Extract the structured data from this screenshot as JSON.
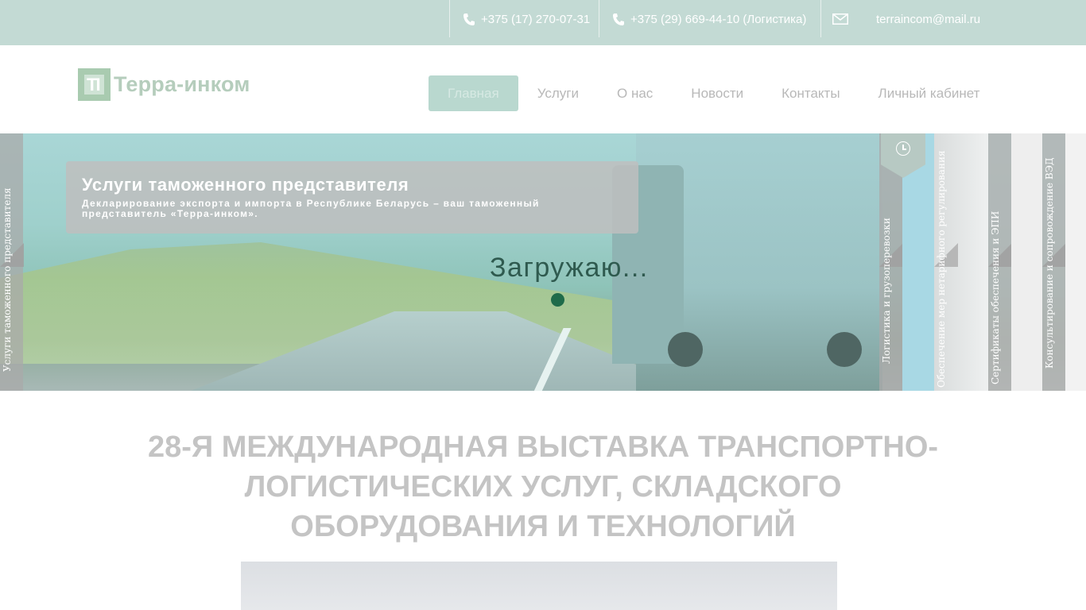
{
  "topbar": {
    "phone1": "+375 (17) 270-07-31",
    "phone2": "+375 (29) 669-44-10 (Логистика)",
    "email": "terraincom@mail.ru",
    "icons": {
      "phone": "phone-icon",
      "email": "envelope-icon"
    }
  },
  "header": {
    "logo_mark": "TI",
    "logo_text": "Терра-инком",
    "nav": [
      {
        "label": "Главная",
        "active": true
      },
      {
        "label": "Услуги"
      },
      {
        "label": "О нас"
      },
      {
        "label": "Новости"
      },
      {
        "label": "Контакты"
      },
      {
        "label": "Личный кабинет"
      }
    ]
  },
  "hero": {
    "caption_title": "Услуги таможенного представителя",
    "caption_text": "Декларирование экспорта и импорта в Республике Беларусь – ваш таможенный представитель «Терра-инком».",
    "loading": "Загружаю...",
    "tabs": [
      {
        "label": "Услуги таможенного представителя"
      },
      {
        "label": "Логистика и грузоперевозки"
      },
      {
        "label": "Обеспечение мер нетарифного регулирования"
      },
      {
        "label": "Сертификаты обеспечения и ЭПИ"
      },
      {
        "label": "Консультирование и сопровождение ВЭД"
      }
    ]
  },
  "main": {
    "news_title": "28-я международная выставка транспортно-логистических услуг, складского оборудования и технологий"
  },
  "colors": {
    "topbar": "#c3dad4",
    "nav_active": "#b9d8cf",
    "loading_dot": "#1f6b4a",
    "title_gray": "#c4c4c4"
  }
}
